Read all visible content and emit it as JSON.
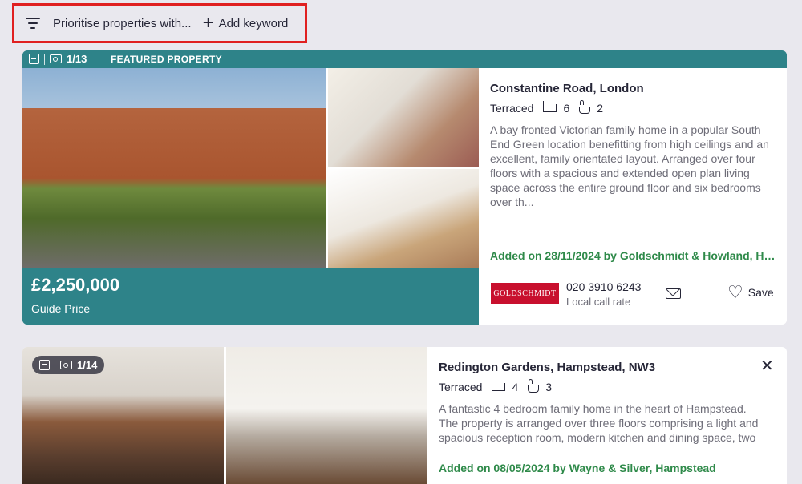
{
  "filter": {
    "prioritise_text": "Prioritise properties with...",
    "add_keyword": "Add keyword"
  },
  "listings": [
    {
      "featured_label": "FEATURED PROPERTY",
      "photo_count": "1/13",
      "price": "£2,250,000",
      "price_qualifier": "Guide Price",
      "address": "Constantine Road, London",
      "property_type": "Terraced",
      "bedrooms": "6",
      "bathrooms": "2",
      "description": "A bay fronted Victorian family home in a popular South End Green location benefitting from high ceilings and an excellent, family orientated layout. Arranged over four floors with a spacious and extended open plan living space across the entire ground floor and six bedrooms over th...",
      "added": "Added on 28/11/2024 by Goldschmidt & Howland, Ham...",
      "agent_logo_text": "GOLDSCHMIDT",
      "phone": "020 3910 6243",
      "phone_note": "Local call rate",
      "save_label": "Save"
    },
    {
      "photo_count": "1/14",
      "address": "Redington Gardens, Hampstead, NW3",
      "property_type": "Terraced",
      "bedrooms": "4",
      "bathrooms": "3",
      "description": "A fantastic 4 bedroom family home in the heart of Hampstead. The property is arranged over three floors comprising a light and spacious reception room, modern kitchen and dining space, two",
      "added": "Added on 08/05/2024 by Wayne & Silver, Hampstead"
    }
  ],
  "icons": {
    "filter": "filter-icon",
    "plus": "plus-icon",
    "floorplan": "floorplan-icon",
    "camera": "camera-icon",
    "bed": "bed-icon",
    "bath": "bath-icon",
    "mail": "mail-icon",
    "heart": "heart-icon",
    "close": "close-icon"
  },
  "colors": {
    "teal": "#2e8389",
    "added_green": "#2f8a4a",
    "highlight_red": "#e02020",
    "agent_red": "#c8102e"
  }
}
